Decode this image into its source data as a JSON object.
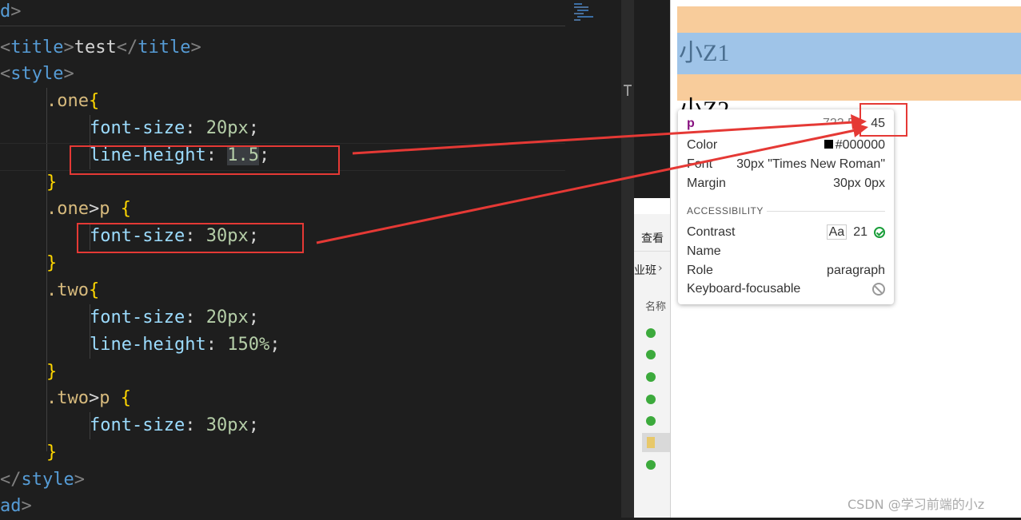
{
  "editor": {
    "lines": {
      "l0": {
        "frag": "d",
        "close": ">"
      },
      "l1": {
        "open_lt": "<",
        "tag": "title",
        "gt": ">",
        "text": "test",
        "close_lt": "</",
        "tag2": "title",
        "gt2": ">"
      },
      "l2": {
        "lt": "<",
        "tag": "style",
        "gt": ">"
      },
      "l3": {
        "sel": ".one",
        "brace": "{"
      },
      "l4": {
        "prop": "font-size",
        "colon": ": ",
        "val": "20px",
        "semi": ";"
      },
      "l5": {
        "prop": "line-height",
        "colon": ": ",
        "val": "1.5",
        "semi": ";"
      },
      "l6": {
        "brace": "}"
      },
      "l7": {
        "sel": ".one",
        "gt": ">",
        "tag": "p",
        "brace": " {"
      },
      "l8": {
        "prop": "font-size",
        "colon": ": ",
        "val": "30px",
        "semi": ";"
      },
      "l9": {
        "brace": "}"
      },
      "l10": {
        "sel": ".two",
        "brace": "{"
      },
      "l11": {
        "prop": "font-size",
        "colon": ": ",
        "val": "20px",
        "semi": ";"
      },
      "l12": {
        "prop": "line-height",
        "colon": ": ",
        "val": "150%",
        "semi": ";"
      },
      "l13": {
        "brace": "}"
      },
      "l14": {
        "sel": ".two",
        "gt": ">",
        "tag": "p",
        "brace": " {"
      },
      "l15": {
        "prop": "font-size",
        "colon": ": ",
        "val": "30px",
        "semi": ";"
      },
      "l16": {
        "brace": "}"
      },
      "l17": {
        "lt": "</",
        "tag": "style",
        "gt": ">"
      },
      "l18": {
        "tag": "ad",
        "gt": ">"
      }
    }
  },
  "explorer": {
    "view_label": "查看",
    "breadcrumb": "业班",
    "column_name": "名称",
    "chevron": "›"
  },
  "browser": {
    "text1": "小Z1",
    "text2": "小Z2",
    "colors": {
      "band": "#f8cc9b",
      "content": "#9fc4e8"
    }
  },
  "tooltip": {
    "tag": "p",
    "dims_partial": "723.5",
    "dims_height": "45",
    "rows": {
      "color": {
        "label": "Color",
        "value": "#000000"
      },
      "font": {
        "label": "Font",
        "value": "30px \"Times New Roman\""
      },
      "margin": {
        "label": "Margin",
        "value": "30px 0px"
      }
    },
    "section": "ACCESSIBILITY",
    "a11y": {
      "contrast": {
        "label": "Contrast",
        "badge": "Aa",
        "value": "21"
      },
      "name": {
        "label": "Name"
      },
      "role": {
        "label": "Role",
        "value": "paragraph"
      },
      "keyboard": {
        "label": "Keyboard-focusable"
      }
    }
  },
  "watermark": "CSDN @学习前端的小z",
  "annotation_color": "#e53935"
}
